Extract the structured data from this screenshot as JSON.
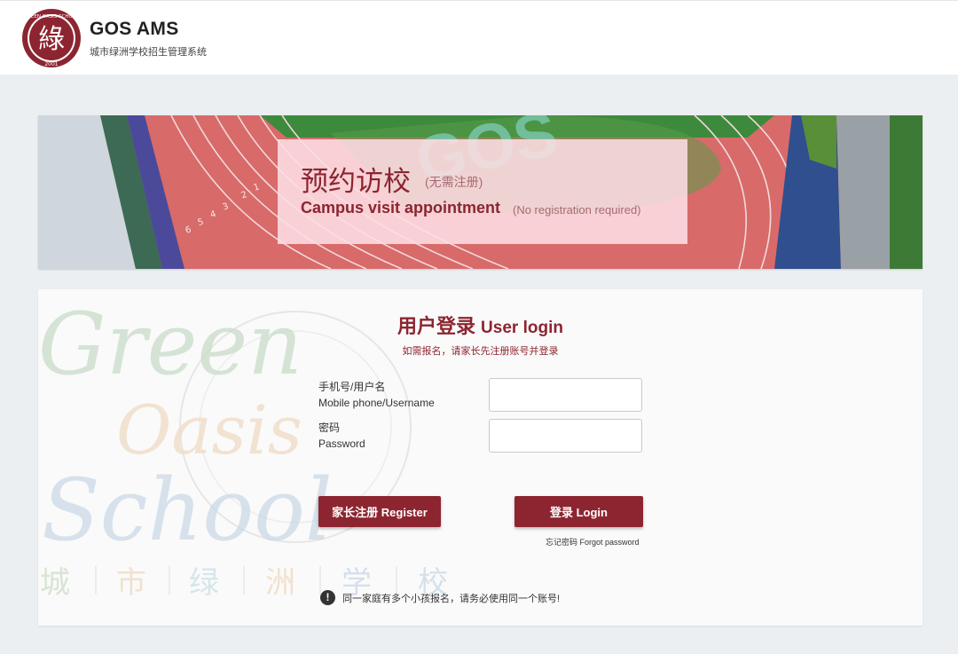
{
  "header": {
    "app_name": "GOS AMS",
    "subtitle": "城市绿洲学校招生管理系统",
    "logo": {
      "glyph": "綠",
      "ring_text": "GREEN OASIS SCHOOL",
      "year": "2001"
    }
  },
  "banner": {
    "title_cn": "预约访校",
    "note_cn": "(无需注册)",
    "title_en": "Campus visit appointment",
    "note_en": "(No registration required)",
    "track_painted_letters": "GOS",
    "lane_numbers": [
      "6",
      "5",
      "4",
      "3",
      "2",
      "1"
    ]
  },
  "login": {
    "title_cn": "用户登录",
    "title_en": "User login",
    "hint": "如需报名，请家长先注册账号并登录",
    "username_label_cn": "手机号/用户名",
    "username_label_en": "Mobile phone/Username",
    "username_value": "",
    "password_label_cn": "密码",
    "password_label_en": "Password",
    "password_value": "",
    "register_button": "家长注册 Register",
    "login_button": "登录 Login",
    "forgot_link": "忘记密码 Forgot password",
    "notice_icon": "exclamation-circle-icon",
    "notice_text": "同一家庭有多个小孩报名，请务必使用同一个账号!"
  },
  "watermark": {
    "word1": "Green",
    "word2": "Oasis",
    "word3": "School",
    "cn_chars": [
      "城",
      "市",
      "绿",
      "洲",
      "学",
      "校"
    ]
  },
  "colors": {
    "brand": "#8c2530",
    "page_bg": "#eceff2",
    "track_red": "#d86a6a",
    "field_green": "#3d8a3d"
  }
}
